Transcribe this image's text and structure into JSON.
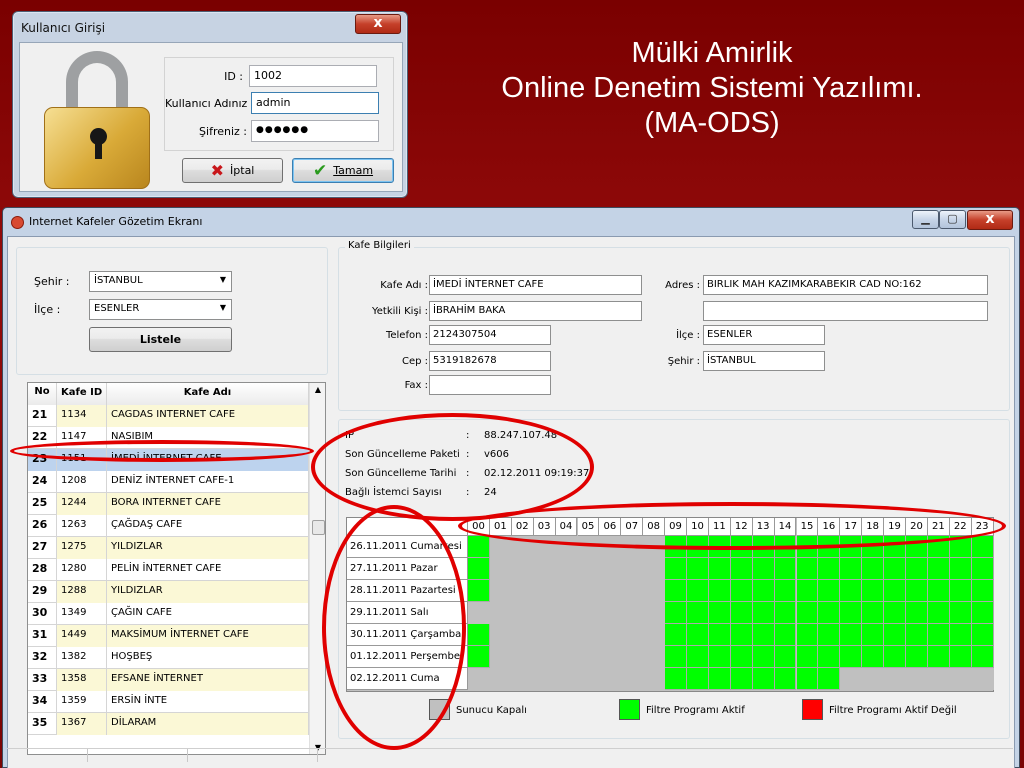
{
  "slide": {
    "title_lines": [
      "Mülki Amirlik",
      "Online Denetim Sistemi Yazılımı.",
      "(MA-ODS)"
    ]
  },
  "login": {
    "title": "Kullanıcı Girişi",
    "close": "x",
    "id_label": "ID :",
    "id_value": "1002",
    "user_label": "Kullanıcı Adınız :",
    "user_value": "admin",
    "pass_label": "Şifreniz :",
    "pass_value": "●●●●●●",
    "cancel_label": "İptal",
    "ok_label": "Tamam"
  },
  "main": {
    "title": "Internet Kafeler Gözetim Ekranı",
    "controls": {
      "min": "▁",
      "max": "▢",
      "close": "x"
    },
    "filter": {
      "city_label": "Şehir :",
      "city_value": "İSTANBUL",
      "district_label": "İlçe :",
      "district_value": "ESENLER",
      "list_button": "Listele"
    },
    "grid": {
      "columns": [
        "No",
        "Kafe ID",
        "Kafe Adı"
      ],
      "rows": [
        {
          "no": "21",
          "id": "1134",
          "name": "CAGDAS INTERNET CAFE"
        },
        {
          "no": "22",
          "id": "1147",
          "name": "NASIBIM"
        },
        {
          "no": "23",
          "id": "1151",
          "name": "İMEDİ İNTERNET CAFE"
        },
        {
          "no": "24",
          "id": "1208",
          "name": "DENİZ İNTERNET CAFE-1"
        },
        {
          "no": "25",
          "id": "1244",
          "name": "BORA INTERNET CAFE"
        },
        {
          "no": "26",
          "id": "1263",
          "name": "ÇAĞDAŞ CAFE"
        },
        {
          "no": "27",
          "id": "1275",
          "name": "YILDIZLAR"
        },
        {
          "no": "28",
          "id": "1280",
          "name": "PELİN İNTERNET CAFE"
        },
        {
          "no": "29",
          "id": "1288",
          "name": "YILDIZLAR"
        },
        {
          "no": "30",
          "id": "1349",
          "name": "ÇAĞIN CAFE"
        },
        {
          "no": "31",
          "id": "1449",
          "name": "MAKSİMUM İNTERNET CAFE"
        },
        {
          "no": "32",
          "id": "1382",
          "name": "HOŞBEŞ"
        },
        {
          "no": "33",
          "id": "1358",
          "name": "EFSANE İNTERNET"
        },
        {
          "no": "34",
          "id": "1359",
          "name": "ERSİN İNTE"
        },
        {
          "no": "35",
          "id": "1367",
          "name": "DİLARAM"
        }
      ],
      "selected_no": "23"
    },
    "info": {
      "group_title": "Kafe Bilgileri",
      "name_label": "Kafe Adı :",
      "name_value": "İMEDİ İNTERNET CAFE",
      "manager_label": "Yetkili Kişi :",
      "manager_value": "İBRAHİM BAKA",
      "phone_label": "Telefon :",
      "phone_value": "2124307504",
      "mobile_label": "Cep :",
      "mobile_value": "5319182678",
      "fax_label": "Fax :",
      "fax_value": "",
      "address_label": "Adres :",
      "address_value": "BIRLIK MAH KAZIMKARABEKIR CAD NO:162",
      "address_value2": "",
      "district_label": "İlçe :",
      "district_value": "ESENLER",
      "city_label": "Şehir :",
      "city_value": "İSTANBUL"
    },
    "detail": {
      "ip_label": "IP",
      "ip_value": "88.247.107.48",
      "pkg_label": "Son Güncelleme Paketi",
      "pkg_value": "v606",
      "date_label": "Son Güncelleme Tarihi",
      "date_value": "02.12.2011 09:19:37",
      "clients_label": "Bağlı İstemci Sayısı",
      "clients_value": "24",
      "sep": ":"
    },
    "schedule": {
      "hours": [
        "00",
        "01",
        "02",
        "03",
        "04",
        "05",
        "06",
        "07",
        "08",
        "09",
        "10",
        "11",
        "12",
        "13",
        "14",
        "15",
        "16",
        "17",
        "18",
        "19",
        "20",
        "21",
        "22",
        "23"
      ],
      "days": [
        {
          "label": "26.11.2011 Cumartesi",
          "active": [
            0,
            9,
            10,
            11,
            12,
            13,
            14,
            15,
            16,
            17,
            18,
            19,
            20,
            21,
            22,
            23
          ]
        },
        {
          "label": "27.11.2011 Pazar",
          "active": [
            0,
            9,
            10,
            11,
            12,
            13,
            14,
            15,
            16,
            17,
            18,
            19,
            20,
            21,
            22,
            23
          ]
        },
        {
          "label": "28.11.2011 Pazartesi",
          "active": [
            0,
            9,
            10,
            11,
            12,
            13,
            14,
            15,
            16,
            17,
            18,
            19,
            20,
            21,
            22,
            23
          ]
        },
        {
          "label": "29.11.2011 Salı",
          "active": [
            9,
            10,
            11,
            12,
            13,
            14,
            15,
            16,
            17,
            18,
            19,
            20,
            21,
            22,
            23
          ]
        },
        {
          "label": "30.11.2011 Çarşamba",
          "active": [
            0,
            9,
            10,
            11,
            12,
            13,
            14,
            15,
            16,
            17,
            18,
            19,
            20,
            21,
            22,
            23
          ]
        },
        {
          "label": "01.12.2011 Perşembe",
          "active": [
            0,
            9,
            10,
            11,
            12,
            13,
            14,
            15,
            16,
            17,
            18,
            19,
            20,
            21,
            22,
            23
          ]
        },
        {
          "label": "02.12.2011 Cuma",
          "active": [
            9,
            10,
            11,
            12,
            13,
            14,
            15,
            16
          ]
        }
      ]
    },
    "legend": {
      "off_label": "Sunucu Kapalı",
      "off_color": "#c0c0c0",
      "active_label": "Filtre Programı Aktif",
      "active_color": "#00ff00",
      "inactive_label": "Filtre Programı Aktif Değil",
      "inactive_color": "#ff0000"
    },
    "colors": {
      "highlight_ring": "#e00000",
      "selected_row": "#bdd3ee",
      "alt_row": "#fbf8d6"
    }
  }
}
